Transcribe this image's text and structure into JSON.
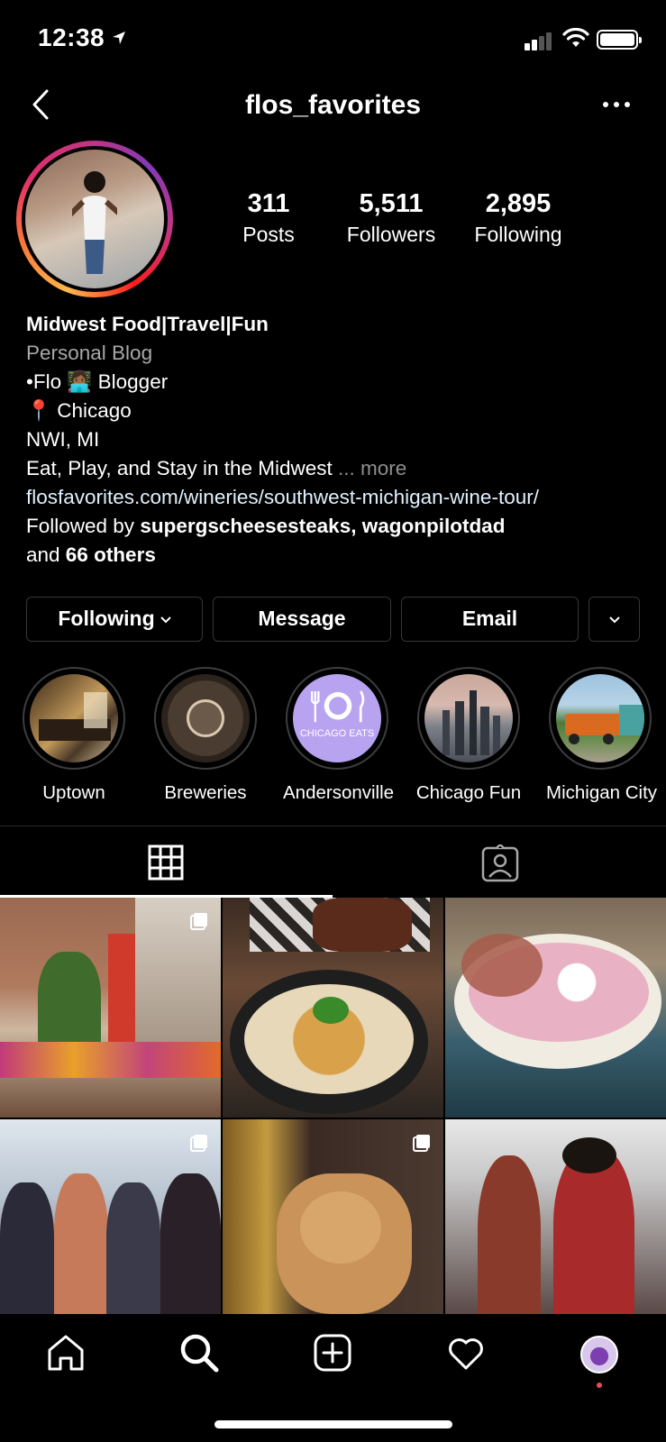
{
  "status": {
    "time": "12:38"
  },
  "header": {
    "username": "flos_favorites"
  },
  "stats": [
    {
      "value": "311",
      "label": "Posts"
    },
    {
      "value": "5,511",
      "label": "Followers"
    },
    {
      "value": "2,895",
      "label": "Following"
    }
  ],
  "bio": {
    "name": "Midwest Food|Travel|Fun",
    "category": "Personal Blog",
    "line1": "•Flo 👩🏾‍💻 Blogger",
    "line2": "📍 Chicago",
    "line3": "NWI, MI",
    "line4": "Eat, Play, and Stay in the Midwest",
    "more": "... more",
    "link": "flosfavorites.com/wineries/southwest-michigan-wine-tour/",
    "followed_by_prefix": "Followed by ",
    "followed_by_users": "supergscheesesteaks, wagonpilotdad",
    "and_prefix": "and ",
    "others": "66 others"
  },
  "buttons": {
    "following": "Following",
    "message": "Message",
    "email": "Email"
  },
  "highlights": [
    {
      "label": "Uptown"
    },
    {
      "label": "Breweries"
    },
    {
      "label": "Andersonville",
      "cover_text": "CHICAGO EATS"
    },
    {
      "label": "Chicago Fun"
    },
    {
      "label": "Michigan City"
    }
  ],
  "colors": {
    "background": "#000000",
    "border": "#363636",
    "secondary_text": "#a8a8a8",
    "link": "#e0f1ff",
    "notification_dot": "#ed4956",
    "highlight_purple": "#b8a3f0"
  },
  "icons": {
    "back": "chevron-left-icon",
    "more": "more-horizontal-icon",
    "grid_tab": "grid-icon",
    "tagged_tab": "tagged-person-icon",
    "nav": [
      "home-icon",
      "search-icon",
      "new-post-icon",
      "heart-icon",
      "profile-avatar"
    ]
  }
}
